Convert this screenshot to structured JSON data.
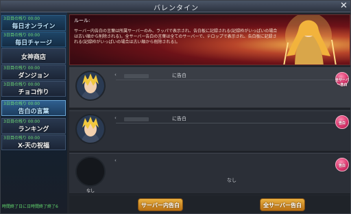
{
  "window": {
    "title": "バレンタイン"
  },
  "sidebar": {
    "items": [
      {
        "tag": "3日目の残り 00:00",
        "label": "毎日オンライン"
      },
      {
        "tag": "3日目の残り 00:00",
        "label": "毎日チャージ"
      },
      {
        "tag": "",
        "label": "女神商店"
      },
      {
        "tag": "3日目の残り 00:00",
        "label": "ダンジョン"
      },
      {
        "tag": "3日目の残り 00:00",
        "label": "チョコ作り"
      },
      {
        "tag": "3日目の残り 00:00",
        "label": "告白の言葉"
      },
      {
        "tag": "3日目の残り 00:00",
        "label": "ランキング"
      },
      {
        "tag": "3日目の残り 00:00",
        "label": "X-天の祝福"
      }
    ],
    "footer": "時間終了日に日時間終了終了6"
  },
  "banner": {
    "rule_title": "ルール:",
    "rule_text": "サーバー内告白の言葉は所属サーバーのみ、ラッパで表示され、告白板に記録される(記録枠がいっぱいの場合は古い順から削除される)。全サーバー告白の言葉は全てのサーバーで、テロップで表示され、告白板に記録される(記録枠がいっぱいの場合は古い順から削除される)。"
  },
  "rows": [
    {
      "name": "",
      "title": "に告白",
      "body": "",
      "badge": "全サーバー告白"
    },
    {
      "name": "",
      "title": "に告白",
      "body": "",
      "badge": "告白"
    },
    {
      "name": "なし",
      "title": "",
      "body": "なし",
      "badge": "告白"
    }
  ],
  "buttons": {
    "server_confess": "サーバー内告白",
    "all_server_confess": "全サーバー告白"
  },
  "colors": {
    "accent": "#e9b142",
    "badge": "#d9336b",
    "sidebar_tag": "#6fe07a"
  }
}
